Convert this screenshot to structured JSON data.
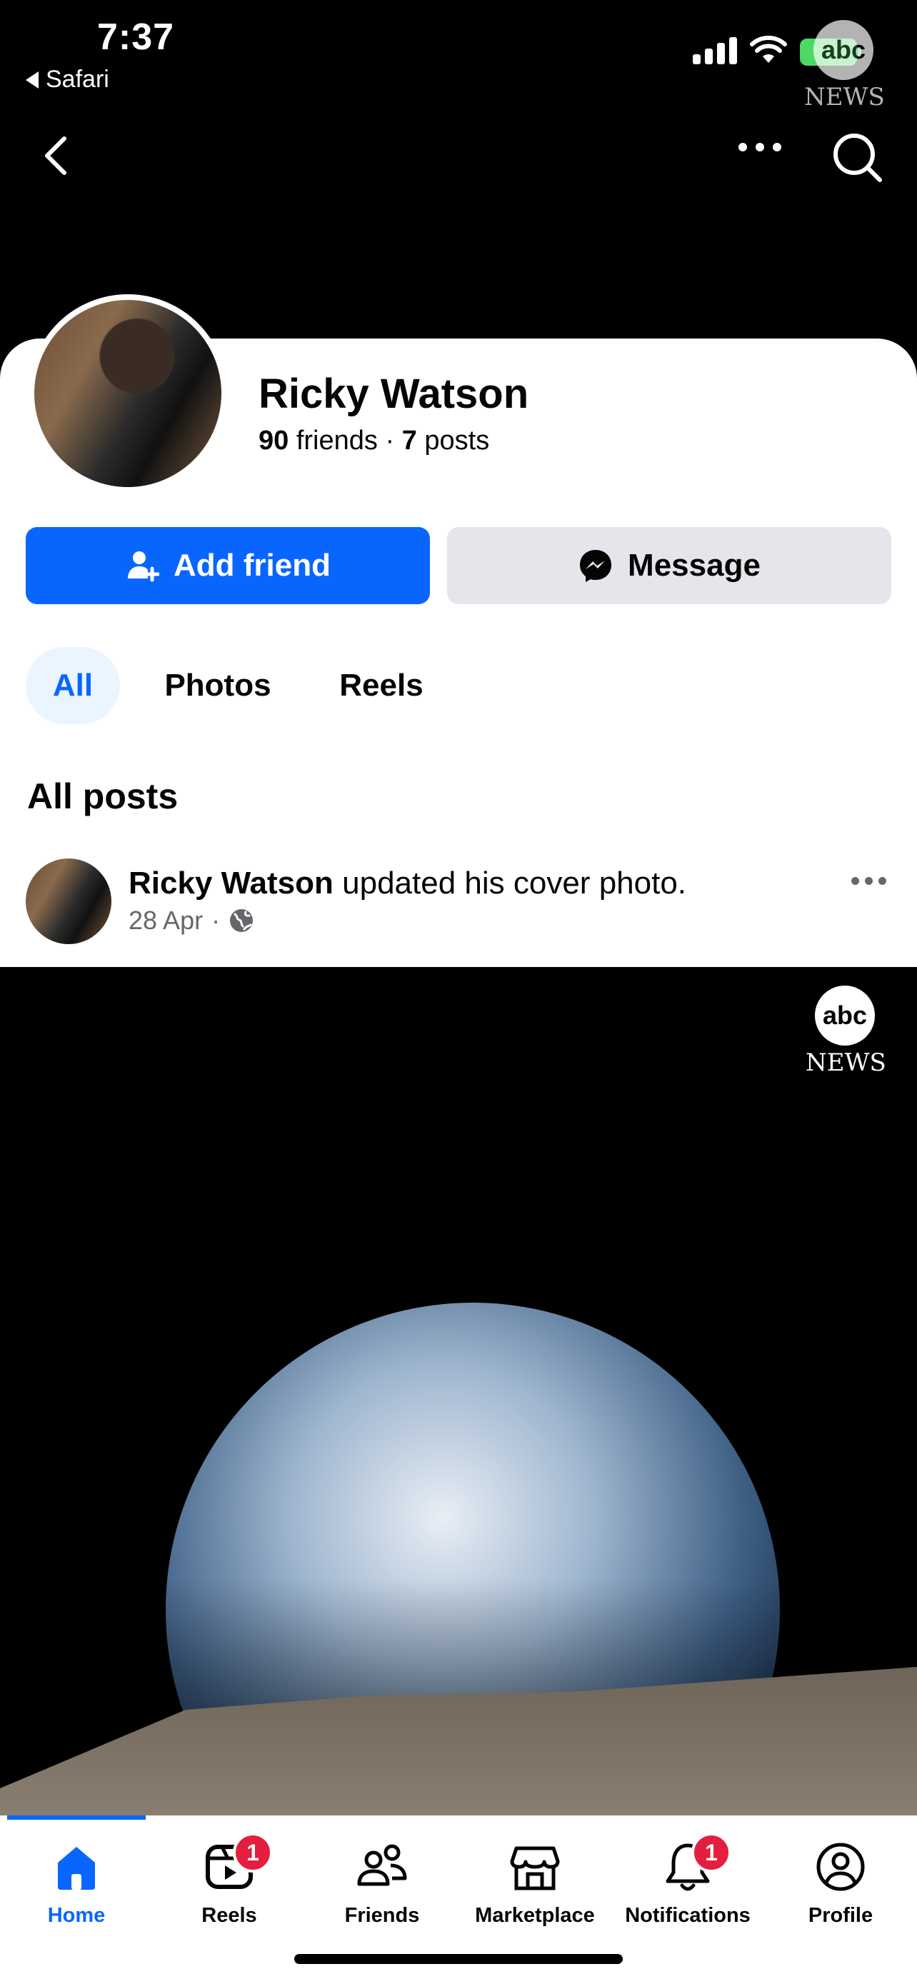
{
  "status_bar": {
    "time": "7:37",
    "back_app": "Safari",
    "watermark_logo": "abc",
    "watermark_text": "NEWS"
  },
  "profile": {
    "name": "Ricky Watson",
    "friends_count": "90",
    "friends_label": "friends",
    "separator": "·",
    "posts_count": "7",
    "posts_label": "posts"
  },
  "actions": {
    "add_friend": "Add friend",
    "message": "Message"
  },
  "filters": [
    "All",
    "Photos",
    "Reels"
  ],
  "section_title": "All posts",
  "post": {
    "author": "Ricky Watson",
    "action": "updated his cover photo.",
    "date": "28 Apr",
    "dot": "·"
  },
  "cover": {
    "logo": "abc",
    "logo_text": "NEWS"
  },
  "tabbar": {
    "items": [
      {
        "label": "Home",
        "icon": "home-icon"
      },
      {
        "label": "Reels",
        "icon": "reels-icon",
        "badge": "1"
      },
      {
        "label": "Friends",
        "icon": "friends-icon"
      },
      {
        "label": "Marketplace",
        "icon": "marketplace-icon"
      },
      {
        "label": "Notifications",
        "icon": "bell-icon",
        "badge": "1"
      },
      {
        "label": "Profile",
        "icon": "profile-icon"
      }
    ]
  },
  "colors": {
    "primary": "#0866ff",
    "badge": "#e41e3f",
    "secondary_button": "#e4e6eb",
    "chip_active_bg": "#ebf5ff"
  }
}
